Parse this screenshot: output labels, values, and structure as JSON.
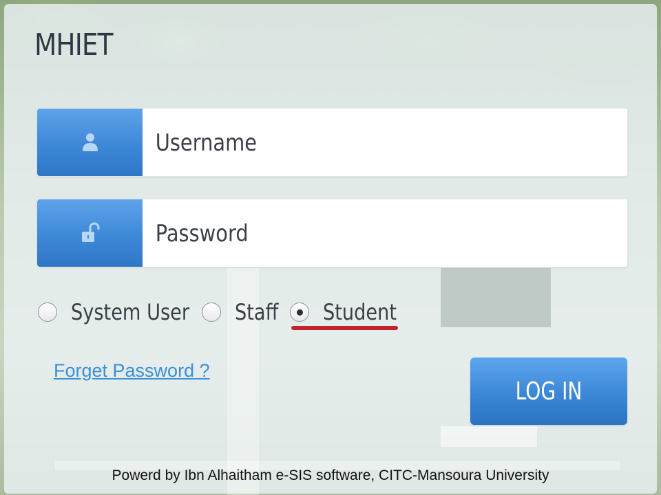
{
  "header": {
    "title": "MHIET"
  },
  "login_form": {
    "username": {
      "placeholder": "Username",
      "value": "",
      "icon": "user-icon"
    },
    "password": {
      "placeholder": "Password",
      "value": "",
      "icon": "unlock-icon"
    },
    "roles": [
      {
        "label": "System User",
        "selected": false
      },
      {
        "label": "Staff",
        "selected": false
      },
      {
        "label": "Student",
        "selected": true
      }
    ],
    "forgot_link": "Forget Password ?",
    "login_button": "LOG IN"
  },
  "footer": {
    "text": "Powerd by Ibn Alhaitham e-SIS software, CITC-Mansoura University"
  },
  "colors": {
    "accent_blue": "#3e88d8",
    "annotation_red": "#c2232e"
  }
}
